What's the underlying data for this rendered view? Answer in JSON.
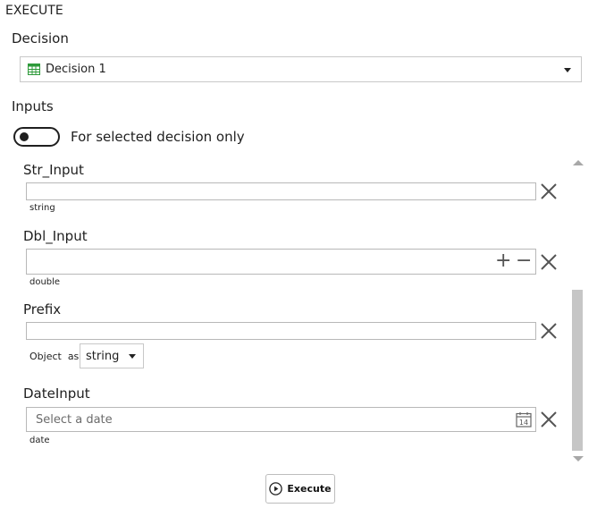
{
  "panel": {
    "title": "EXECUTE"
  },
  "decision": {
    "label": "Decision",
    "selected": "Decision 1",
    "icon": "table-icon",
    "icon_color": "#2e9a3a"
  },
  "inputs": {
    "label": "Inputs",
    "toggle_label": "For selected decision only",
    "toggle_on": false,
    "fields": [
      {
        "name": "Str_Input",
        "value": "",
        "type_hint": "string"
      },
      {
        "name": "Dbl_Input",
        "value": "",
        "type_hint": "double",
        "plus": "+",
        "minus": "−"
      },
      {
        "name": "Prefix",
        "value": "",
        "object_as_label": "Object  as",
        "object_as_value": "string"
      },
      {
        "name": "DateInput",
        "placeholder": "Select a date",
        "type_hint": "date",
        "calendar_day": "14"
      }
    ]
  },
  "actions": {
    "execute_label": "Execute"
  }
}
